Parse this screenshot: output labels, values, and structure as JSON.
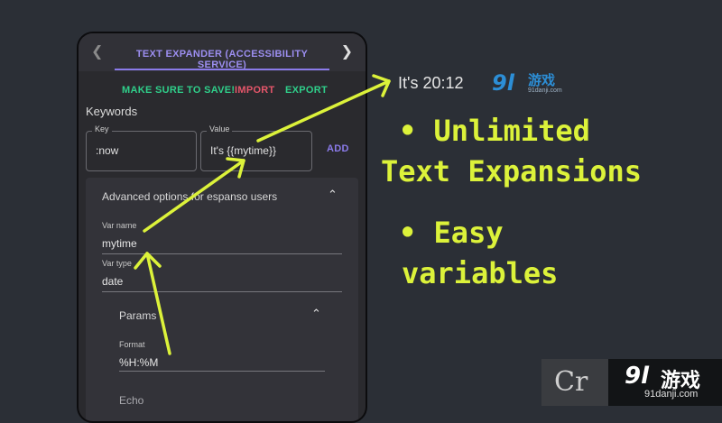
{
  "colors": {
    "background": "#2b2f36",
    "accent": "#8b7bea",
    "green": "#2fcf8a",
    "red": "#e5566a",
    "highlight": "#dcf23a",
    "logo_blue": "#2c8ed6"
  },
  "app": {
    "tab_title": "TEXT EXPANDER (ACCESSIBILITY SERVICE)",
    "prev_icon": "chevron-left-icon",
    "next_icon": "chevron-right-icon",
    "actions": {
      "save_reminder": "MAKE SURE TO SAVE!",
      "import": "IMPORT",
      "export": "EXPORT"
    },
    "keywords_label": "Keywords",
    "key_field": {
      "label": "Key",
      "value": ":now"
    },
    "value_field": {
      "label": "Value",
      "value": "It's {{mytime}}"
    },
    "add_button": "ADD",
    "advanced": {
      "title": "Advanced options for espanso users",
      "var_name_label": "Var name",
      "var_name_value": "mytime",
      "var_type_label": "Var type",
      "var_type_value": "date",
      "params_title": "Params",
      "format_label": "Format",
      "format_value": "%H:%M",
      "echo_label": "Echo"
    }
  },
  "result_text": "It's 20:12",
  "logo": {
    "mark": "9l",
    "cn": "游戏",
    "url": "91danji.com"
  },
  "headline": {
    "line1": "• Unlimited",
    "line2": "Text Expansions",
    "line3": "• Easy",
    "line4": "variables"
  },
  "watermark": {
    "box": "Cr",
    "mark": "9l",
    "cn": "游戏",
    "url": "91danji.com"
  }
}
